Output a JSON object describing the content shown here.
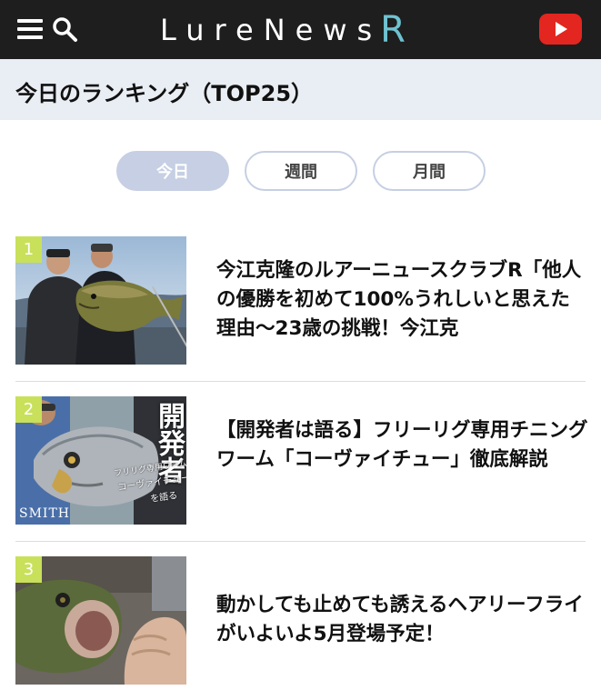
{
  "header": {
    "logo_main": "LureNews",
    "logo_accent": "R",
    "menu_icon": "hamburger-menu-icon",
    "search_icon": "search-icon",
    "youtube_icon": "youtube-play-icon",
    "colors": {
      "bar": "#1e1e1e",
      "logo_accent": "#6fc2d0",
      "youtube": "#e3261f"
    }
  },
  "section": {
    "title": "今日のランキング（TOP25）"
  },
  "tabs": [
    {
      "label": "今日",
      "active": true
    },
    {
      "label": "週間",
      "active": false
    },
    {
      "label": "月間",
      "active": false
    }
  ],
  "rankings": [
    {
      "rank": "1",
      "title": "今江克隆のルアーニュースクラブR「他人の優勝を初めて100%うれしいと思えた理由〜23歳の挑戦！今江克"
    },
    {
      "rank": "2",
      "title": "【開発者は語る】フリーリグ専用チニングワーム「コーヴァイチュー」徹底解説",
      "thumb_text": {
        "big": "開発者",
        "line1": "フリリグ専用ワーム",
        "line2": "コーヴァイチュー",
        "line3": "を語る",
        "brand": "SMITH"
      }
    },
    {
      "rank": "3",
      "title": "動かしても止めても誘えるヘアリーフライがいよいよ5月登場予定！"
    }
  ],
  "colors": {
    "section_bg": "#e9edf4",
    "tab_active_bg": "#c6cfe3",
    "rank_badge": "#c8e05a"
  }
}
